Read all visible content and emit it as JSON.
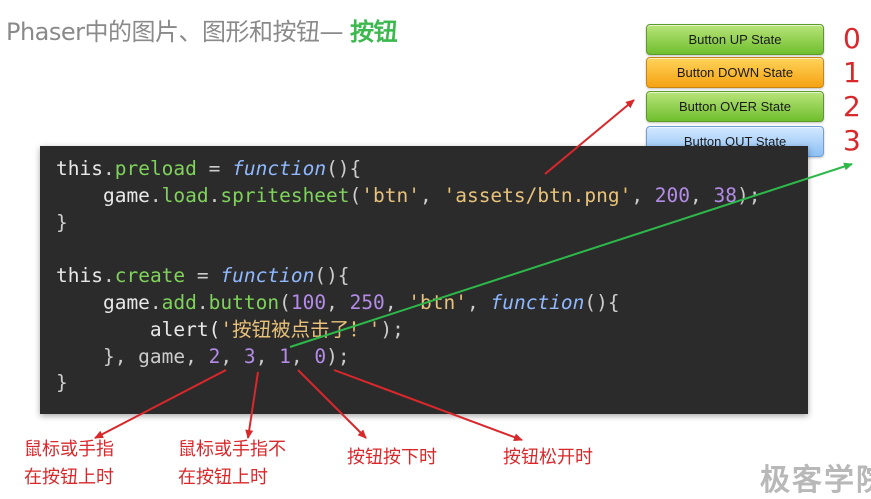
{
  "title": {
    "prefix": "Phaser中的图片、图形和按钮— ",
    "highlight": "按钮"
  },
  "button_states": [
    {
      "label": "Button UP State",
      "index": "0"
    },
    {
      "label": "Button DOWN State",
      "index": "1"
    },
    {
      "label": "Button OVER State",
      "index": "2"
    },
    {
      "label": "Button OUT State",
      "index": "3"
    }
  ],
  "code": {
    "line1": {
      "a": "this",
      "b": ".",
      "c": "preload",
      "d": " = ",
      "e": "function",
      "f": "(){"
    },
    "line2": {
      "a": "    game",
      "b": ".",
      "c": "load",
      "d": ".",
      "e": "spritesheet",
      "f": "(",
      "g": "'btn'",
      "h": ", ",
      "i": "'assets/btn.png'",
      "j": ", ",
      "k": "200",
      "l": ", ",
      "m": "38",
      "n": ");"
    },
    "line3": "}",
    "line5": {
      "a": "this",
      "b": ".",
      "c": "create",
      "d": " = ",
      "e": "function",
      "f": "(){"
    },
    "line6": {
      "a": "    game",
      "b": ".",
      "c": "add",
      "d": ".",
      "e": "button",
      "f": "(",
      "g": "100",
      "h": ", ",
      "i": "250",
      "j": ", ",
      "k": "'btn'",
      "l": ", ",
      "m": "function",
      "n": "(){"
    },
    "line7": {
      "a": "        alert(",
      "b": "'按钮被点击了！'",
      "c": ");"
    },
    "line8": {
      "a": "    }, game, ",
      "b": "2",
      "c": ", ",
      "d": "3",
      "e": ", ",
      "f": "1",
      "g": ", ",
      "h": "0",
      "i": ");"
    },
    "line9": "}"
  },
  "annotations": [
    {
      "line1": "鼠标或手指",
      "line2": "在按钮上时"
    },
    {
      "line1": "鼠标或手指不",
      "line2": "在按钮上时"
    },
    {
      "line1": "按钮按下时"
    },
    {
      "line1": "按钮松开时"
    }
  ],
  "watermark": "极客学院",
  "colors": {
    "accent_red": "#d8282b",
    "accent_green": "#3cb84e",
    "code_bg": "#2b2b2b"
  }
}
